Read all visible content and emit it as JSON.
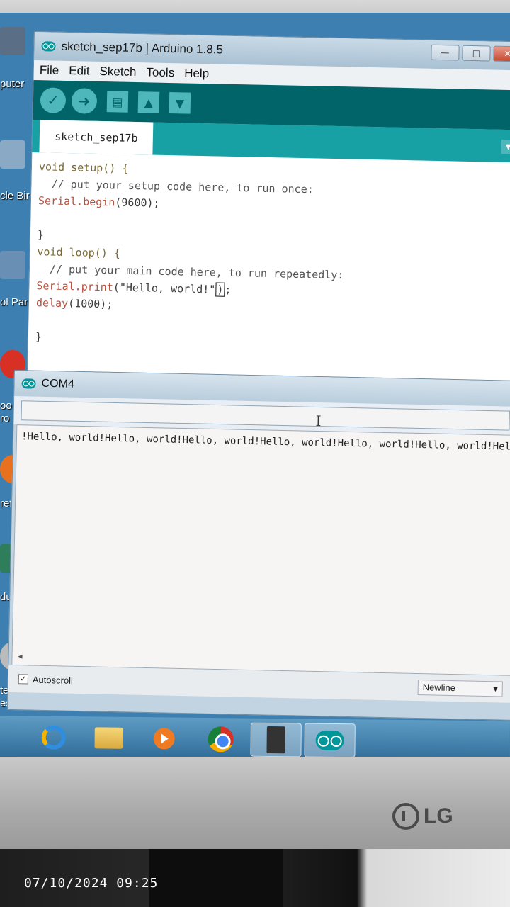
{
  "ide": {
    "title": "sketch_sep17b | Arduino 1.8.5",
    "menu": [
      "File",
      "Edit",
      "Sketch",
      "Tools",
      "Help"
    ],
    "tab_label": "sketch_sep17b",
    "code": {
      "l1": "void setup() {",
      "l2": "  // put your setup code here, to run once:",
      "l3_fn": "Serial.begin",
      "l3_rest": "(9600);",
      "l5": "}",
      "l6": "void loop() {",
      "l7": "  // put your main code here, to run repeatedly:",
      "l8_fn": "Serial.print",
      "l8_rest": "(\"Hello, world!\"",
      "l8_cursor": ")",
      "l8_end": ";",
      "l9_fn": "delay",
      "l9_rest": "(1000);",
      "l11": "}"
    }
  },
  "serial": {
    "title": "COM4",
    "send_value": "",
    "output": "!Hello, world!Hello, world!Hello, world!Hello, world!Hello, world!Hello, world!Hello, w",
    "autoscroll_label": "Autoscroll",
    "autoscroll_checked": "✓",
    "line_ending": "Newline"
  },
  "desktop": {
    "icon_labels": [
      "puter",
      "cle Bir",
      "ol Pan",
      "oo",
      "ro",
      "ref",
      "du",
      "te",
      "ess"
    ]
  },
  "monitor": {
    "brand": "LG"
  },
  "photo": {
    "timestamp": "07/10/2024  09:25"
  },
  "colors": {
    "arduino_teal": "#00979c",
    "toolbar_dark": "#006468",
    "taskbar": "#2f6c99"
  },
  "icons": [
    "verify-icon",
    "upload-icon",
    "new-icon",
    "open-icon",
    "save-icon",
    "serial-monitor-icon",
    "ie-icon",
    "explorer-icon",
    "media-player-icon",
    "chrome-icon",
    "device-icon",
    "arduino-icon"
  ]
}
